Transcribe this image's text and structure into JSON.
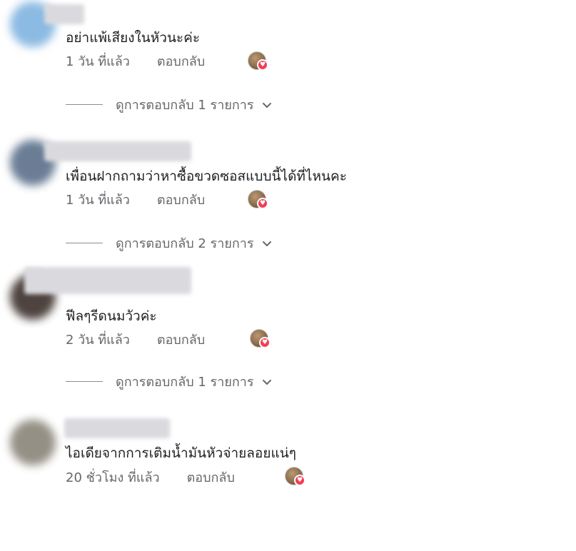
{
  "comments": [
    {
      "text": "อย่าแพ้เสียงในหัวนะค่ะ",
      "time": "1 วัน ที่แล้ว",
      "reply_label": "ตอบกลับ",
      "view_replies": "ดูการตอบกลับ 1 รายการ",
      "avatar_color": "#7fb3e0",
      "reaction": "love"
    },
    {
      "text": "เพื่อนฝากถามว่าหาซื้อขวดซอสแบบนี้ได้ที่ไหนคะ",
      "time": "1 วัน ที่แล้ว",
      "reply_label": "ตอบกลับ",
      "view_replies": "ดูการตอบกลับ 2 รายการ",
      "avatar_color": "#5a6f8a",
      "reaction": "love"
    },
    {
      "text": "ฟีลๆรีดนมวัวค่ะ",
      "time": "2 วัน ที่แล้ว",
      "reply_label": "ตอบกลับ",
      "view_replies": "ดูการตอบกลับ 1 รายการ",
      "avatar_color": "#3b2f2a",
      "reaction": "love"
    },
    {
      "text": "ไอเดียจากการเติมน้ำมันหัวจ่ายลอยแน่ๆ",
      "time": "20 ชั่วโมง ที่แล้ว",
      "reply_label": "ตอบกลับ",
      "avatar_color": "#8a8478",
      "reaction": "love"
    }
  ],
  "colors": {
    "text": "#1c1e21",
    "meta": "#65676b",
    "love_reaction": "#f33e58"
  },
  "icons": {
    "reaction": "love-reaction-icon",
    "expand": "chevron-down-icon"
  }
}
